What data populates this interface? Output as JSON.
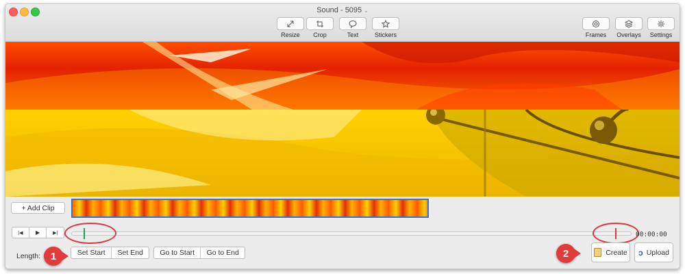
{
  "window": {
    "title": "Sound - 5095"
  },
  "toolbar": {
    "resize": "Resize",
    "crop": "Crop",
    "text": "Text",
    "stickers": "Stickers",
    "frames": "Frames",
    "overlays": "Overlays",
    "settings": "Settings"
  },
  "icons": {
    "resize": "resize-arrows-icon",
    "crop": "crop-icon",
    "text": "speech-bubble-icon",
    "stickers": "star-icon",
    "frames": "frames-icon",
    "overlays": "layers-icon",
    "settings": "gear-icon",
    "create": "document-icon",
    "upload": "upload-logo-icon"
  },
  "timeline": {
    "add_clip_label": "+ Add Clip",
    "timecode": "00:00:00"
  },
  "controls": {
    "length_label": "Length:",
    "set_start": "Set Start",
    "set_end": "Set End",
    "go_to_start": "Go to Start",
    "go_to_end": "Go to End",
    "create": "Create",
    "upload": "Upload"
  },
  "annotations": {
    "step1": "1",
    "step2": "2"
  },
  "colors": {
    "annotation_red": "#e23b3b",
    "clip_border": "#3b6fd6",
    "start_marker": "#1a9e5a",
    "end_marker": "#d8383f"
  }
}
